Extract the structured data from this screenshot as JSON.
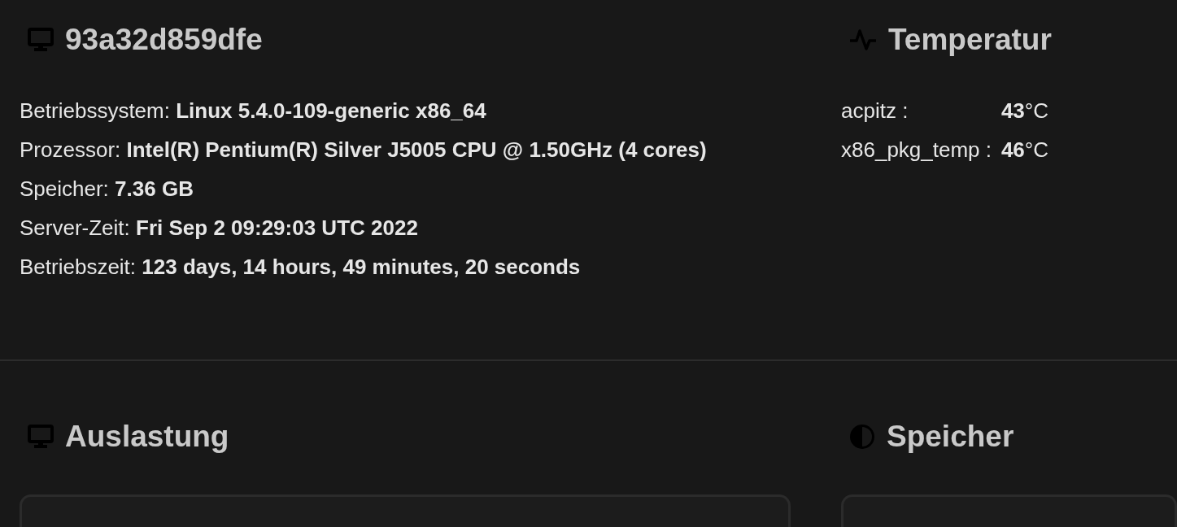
{
  "system": {
    "title": "93a32d859dfe",
    "facts": [
      {
        "label": "Betriebssystem:",
        "value": "Linux 5.4.0-109-generic x86_64"
      },
      {
        "label": "Prozessor:",
        "value": "Intel(R) Pentium(R) Silver J5005 CPU @ 1.50GHz (4 cores)"
      },
      {
        "label": "Speicher:",
        "value": "7.36 GB"
      },
      {
        "label": "Server-Zeit:",
        "value": "Fri Sep 2 09:29:03 UTC 2022"
      },
      {
        "label": "Betriebszeit:",
        "value": "123 days, 14 hours, 49 minutes, 20 seconds"
      }
    ]
  },
  "temperature": {
    "title": "Temperatur",
    "sensors": [
      {
        "label": "acpitz :",
        "value": "**43**°C"
      },
      {
        "label": "x86_pkg_temp :",
        "value": "**46**°C"
      }
    ]
  },
  "load": {
    "title": "Auslastung"
  },
  "memory": {
    "title": "Speicher"
  }
}
